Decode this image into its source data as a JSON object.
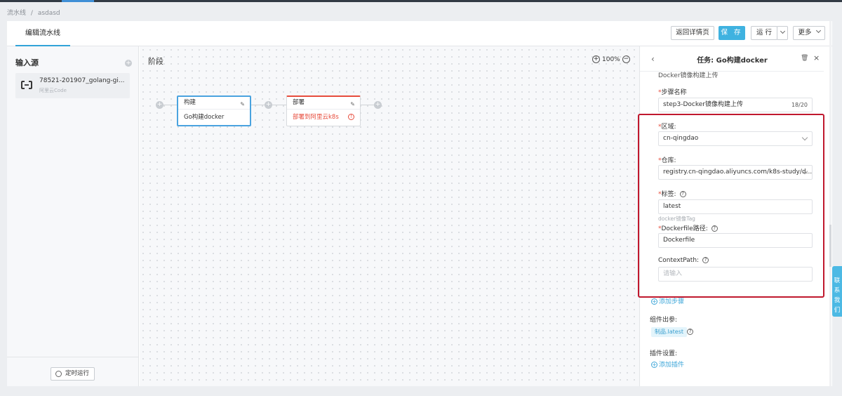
{
  "breadcrumb": {
    "root": "流水线",
    "separator": "/",
    "current": "asdasd"
  },
  "tabs": [
    {
      "label": "编辑流水线",
      "active": true
    }
  ],
  "toolbar": {
    "back_label": "返回详情页",
    "save_label": "保 存",
    "run_label": "运 行",
    "more_label": "更多"
  },
  "left": {
    "title": "输入源",
    "source": {
      "name": "78521-201907_golang-gi...",
      "sub": "阿里云Code"
    },
    "schedule_label": "定时运行"
  },
  "canvas": {
    "title": "阶段",
    "zoom": "100%",
    "stages": [
      {
        "name": "构建",
        "task": "Go构建docker",
        "status": "selected"
      },
      {
        "name": "部署",
        "task": "部署到阿里云k8s",
        "status": "error"
      }
    ]
  },
  "panel": {
    "title": "任务: Go构建docker",
    "section_partial": "Docker镜像构建上传",
    "step_name_label": "步骤名称",
    "step_name_value": "step3-Docker镜像构建上传",
    "step_name_count": "18/20",
    "region_label": "区域:",
    "region_value": "cn-qingdao",
    "repo_label": "仓库:",
    "repo_value": "registry.cn-qingdao.aliyuncs.com/k8s-study/d...",
    "tag_label": "标签:",
    "tag_value": "latest",
    "tag_help": "docker镜像Tag",
    "dockerfile_label": "Dockerfile路径:",
    "dockerfile_value": "Dockerfile",
    "context_label": "ContextPath:",
    "context_placeholder": "请输入",
    "add_step": "添加步骤",
    "output_label": "组件出参:",
    "output_tag": "制品.latest",
    "plugin_label": "插件设置:",
    "add_plugin": "添加插件"
  },
  "contact": "联系我们",
  "colors": {
    "accent": "#3fb2e0",
    "error": "#e74c3c",
    "highlight_box": "#c0182e"
  }
}
